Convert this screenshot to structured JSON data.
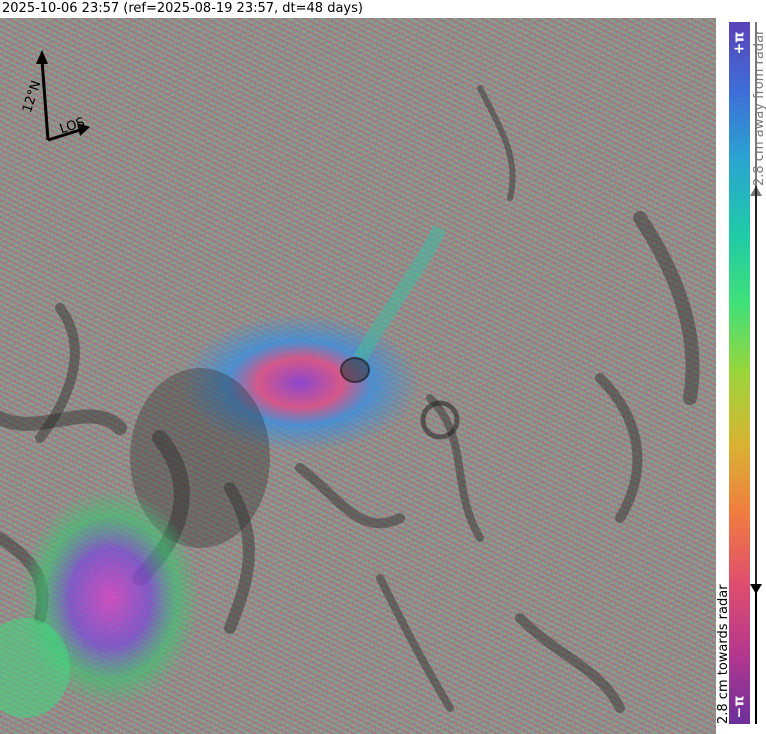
{
  "title": "2025-10-06 23:57 (ref=2025-08-19 23:57, dt=48 days)",
  "map": {
    "north_label": "12°N",
    "los_label": "LOS"
  },
  "colorbar": {
    "max_label": "+π",
    "min_label": "−π",
    "away_label": "2.8 cm away from radar",
    "toward_label": "2.8 cm towards radar",
    "colors": [
      "#6b2f9a",
      "#b4388e",
      "#e04e6d",
      "#f07c40",
      "#d8b432",
      "#9ad53a",
      "#3fe07a",
      "#1fc9a8",
      "#2aa6d0",
      "#3e6fd8",
      "#5a42b8"
    ]
  }
}
